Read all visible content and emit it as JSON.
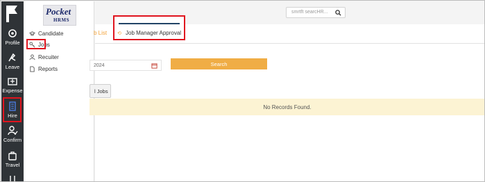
{
  "rail": {
    "items": [
      {
        "label": "Profile",
        "icon": "gear-icon"
      },
      {
        "label": "Leave",
        "icon": "leave-icon"
      },
      {
        "label": "Expense",
        "icon": "expense-icon"
      },
      {
        "label": "Hire",
        "icon": "hire-icon"
      },
      {
        "label": "Confirm",
        "icon": "confirm-icon"
      },
      {
        "label": "Travel",
        "icon": "travel-icon"
      }
    ]
  },
  "brand": {
    "line1": "Pocket",
    "line2": "HRMS"
  },
  "submenu": {
    "items": [
      {
        "label": "Candidate",
        "icon": "graduation-cap-icon"
      },
      {
        "label": "Jobs",
        "icon": "key-icon"
      },
      {
        "label": "Recuiter",
        "icon": "user-icon"
      },
      {
        "label": "Reports",
        "icon": "document-icon"
      }
    ]
  },
  "header": {
    "search_placeholder": "smrtft searcHR..."
  },
  "tabs": [
    {
      "label": "b List"
    },
    {
      "label": "Job Manager Approval"
    }
  ],
  "filter": {
    "date_value": "2024",
    "search_button": "Search"
  },
  "actions": {
    "add_jobs": "l Jobs"
  },
  "results": {
    "empty_message": "No Records Found."
  },
  "colors": {
    "accent": "#f0ad45",
    "highlight": "#e0141e",
    "rail": "#2f3337"
  }
}
